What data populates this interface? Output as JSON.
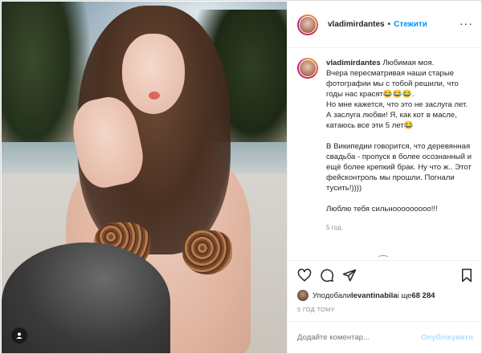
{
  "post": {
    "username": "vladimirdantes",
    "separator": "•",
    "follow_label": "Стежити",
    "more_label": "···"
  },
  "caption": {
    "username": "vladimirdantes",
    "para1": "Любимая моя.\nВчера пересматривая наши старые фотографии мы с тобой решили, что годы нас красят😂😂😂.\nНо мне кажется, что это не заслуга лет. А заслуга любви! Я, как кот в масле, катаюсь все эти 5 лет😂",
    "para2": "В Википедии говорится, что деревянная свадьба - пропуск в более осознанный и ещё более крепкий брак. Ну что ж.. Этот фейсконтроль мы прошли. Погнали тусить!))))",
    "para3": "Люблю тебя сильнооооооооо!!!",
    "time": "5 год."
  },
  "actions": {
    "like_icon": "heart-icon",
    "comment_icon": "comment-icon",
    "share_icon": "paper-plane-icon",
    "save_icon": "bookmark-icon"
  },
  "likes": {
    "prefix": "Уподобали ",
    "user": "levantinabila",
    "middle": " і ще ",
    "count": "68 284"
  },
  "date": "5 ГОД ТОМУ",
  "comment": {
    "placeholder": "Додайте коментар...",
    "post_label": "Опублікувати"
  },
  "colors": {
    "accent": "#0095f6",
    "accent_disabled": "#b2dffc",
    "muted": "#8e8e8e"
  }
}
